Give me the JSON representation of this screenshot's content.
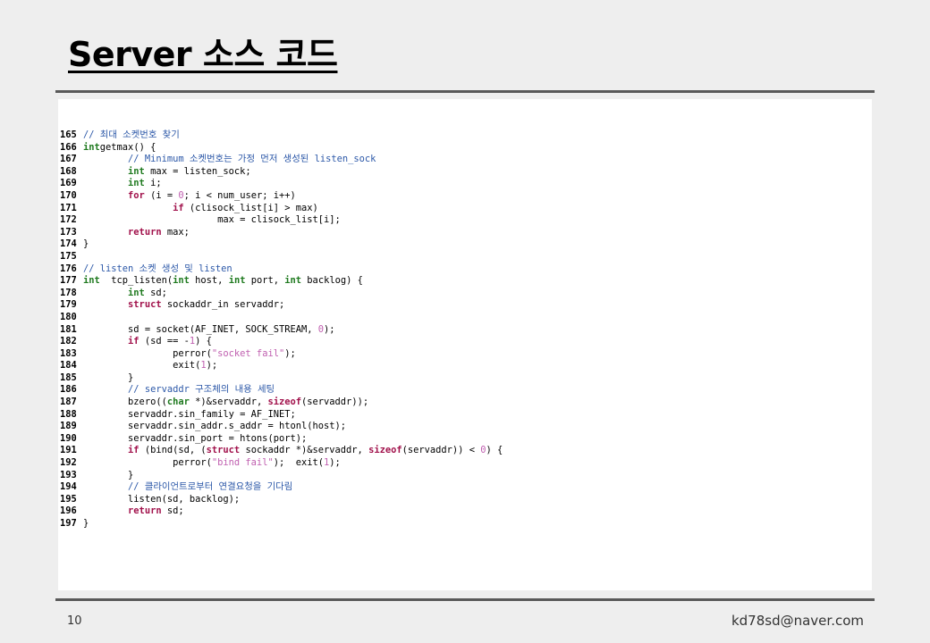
{
  "slide": {
    "title": "Server 소스 코드",
    "page_number": "10",
    "email": "kd78sd@naver.com"
  },
  "code_lines": [
    {
      "n": "165",
      "tokens": [
        [
          "cm",
          "// 최대 소켓번호 찾기"
        ]
      ]
    },
    {
      "n": "166",
      "tokens": [
        [
          "ty",
          "int"
        ],
        [
          "",
          "getmax() {"
        ]
      ]
    },
    {
      "n": "167",
      "tokens": [
        [
          "",
          "        "
        ],
        [
          "cm",
          "// Minimum 소켓번호는 가정 먼저 생성된 listen_sock"
        ]
      ]
    },
    {
      "n": "168",
      "tokens": [
        [
          "",
          "        "
        ],
        [
          "ty",
          "int"
        ],
        [
          "",
          " max = listen_sock;"
        ]
      ]
    },
    {
      "n": "169",
      "tokens": [
        [
          "",
          "        "
        ],
        [
          "ty",
          "int"
        ],
        [
          "",
          " i;"
        ]
      ]
    },
    {
      "n": "170",
      "tokens": [
        [
          "",
          "        "
        ],
        [
          "kw",
          "for"
        ],
        [
          "",
          " (i = "
        ],
        [
          "nm",
          "0"
        ],
        [
          "",
          "; i < num_user; i++)"
        ]
      ]
    },
    {
      "n": "171",
      "tokens": [
        [
          "",
          "                "
        ],
        [
          "kw",
          "if"
        ],
        [
          "",
          " (clisock_list[i] > max)"
        ]
      ]
    },
    {
      "n": "172",
      "tokens": [
        [
          "",
          "                        max = clisock_list[i];"
        ]
      ]
    },
    {
      "n": "173",
      "tokens": [
        [
          "",
          "        "
        ],
        [
          "kw",
          "return"
        ],
        [
          "",
          " max;"
        ]
      ]
    },
    {
      "n": "174",
      "tokens": [
        [
          "",
          "}"
        ]
      ]
    },
    {
      "n": "175",
      "tokens": []
    },
    {
      "n": "176",
      "tokens": [
        [
          "cm",
          "// listen 소켓 생성 및 listen"
        ]
      ]
    },
    {
      "n": "177",
      "tokens": [
        [
          "ty",
          "int"
        ],
        [
          "",
          "  tcp_listen("
        ],
        [
          "ty",
          "int"
        ],
        [
          "",
          " host, "
        ],
        [
          "ty",
          "int"
        ],
        [
          "",
          " port, "
        ],
        [
          "ty",
          "int"
        ],
        [
          "",
          " backlog) {"
        ]
      ]
    },
    {
      "n": "178",
      "tokens": [
        [
          "",
          "        "
        ],
        [
          "ty",
          "int"
        ],
        [
          "",
          " sd;"
        ]
      ]
    },
    {
      "n": "179",
      "tokens": [
        [
          "",
          "        "
        ],
        [
          "kw",
          "struct"
        ],
        [
          "",
          " sockaddr_in servaddr;"
        ]
      ]
    },
    {
      "n": "180",
      "tokens": []
    },
    {
      "n": "181",
      "tokens": [
        [
          "",
          "        sd = socket(AF_INET, SOCK_STREAM, "
        ],
        [
          "nm",
          "0"
        ],
        [
          "",
          ");"
        ]
      ]
    },
    {
      "n": "182",
      "tokens": [
        [
          "",
          "        "
        ],
        [
          "kw",
          "if"
        ],
        [
          "",
          " (sd == -"
        ],
        [
          "nm",
          "1"
        ],
        [
          "",
          ") {"
        ]
      ]
    },
    {
      "n": "183",
      "tokens": [
        [
          "",
          "                perror("
        ],
        [
          "st",
          "\"socket fail\""
        ],
        [
          "",
          ");"
        ]
      ]
    },
    {
      "n": "184",
      "tokens": [
        [
          "",
          "                exit("
        ],
        [
          "nm",
          "1"
        ],
        [
          "",
          ");"
        ]
      ]
    },
    {
      "n": "185",
      "tokens": [
        [
          "",
          "        }"
        ]
      ]
    },
    {
      "n": "186",
      "tokens": [
        [
          "",
          "        "
        ],
        [
          "cm",
          "// servaddr 구조체의 내용 세팅"
        ]
      ]
    },
    {
      "n": "187",
      "tokens": [
        [
          "",
          "        bzero(("
        ],
        [
          "ty",
          "char"
        ],
        [
          "",
          " *)&servaddr, "
        ],
        [
          "kw",
          "sizeof"
        ],
        [
          "",
          "(servaddr));"
        ]
      ]
    },
    {
      "n": "188",
      "tokens": [
        [
          "",
          "        servaddr.sin_family = AF_INET;"
        ]
      ]
    },
    {
      "n": "189",
      "tokens": [
        [
          "",
          "        servaddr.sin_addr.s_addr = htonl(host);"
        ]
      ]
    },
    {
      "n": "190",
      "tokens": [
        [
          "",
          "        servaddr.sin_port = htons(port);"
        ]
      ]
    },
    {
      "n": "191",
      "tokens": [
        [
          "",
          "        "
        ],
        [
          "kw",
          "if"
        ],
        [
          "",
          " (bind(sd, ("
        ],
        [
          "kw",
          "struct"
        ],
        [
          "",
          " sockaddr *)&servaddr, "
        ],
        [
          "kw",
          "sizeof"
        ],
        [
          "",
          "(servaddr)) < "
        ],
        [
          "nm",
          "0"
        ],
        [
          "",
          ") {"
        ]
      ]
    },
    {
      "n": "192",
      "tokens": [
        [
          "",
          "                perror("
        ],
        [
          "st",
          "\"bind fail\""
        ],
        [
          "",
          ");  exit("
        ],
        [
          "nm",
          "1"
        ],
        [
          "",
          ");"
        ]
      ]
    },
    {
      "n": "193",
      "tokens": [
        [
          "",
          "        }"
        ]
      ]
    },
    {
      "n": "194",
      "tokens": [
        [
          "",
          "        "
        ],
        [
          "cm",
          "// 클라이언트로부터 연결요청을 기다림"
        ]
      ]
    },
    {
      "n": "195",
      "tokens": [
        [
          "",
          "        listen(sd, backlog);"
        ]
      ]
    },
    {
      "n": "196",
      "tokens": [
        [
          "",
          "        "
        ],
        [
          "kw",
          "return"
        ],
        [
          "",
          " sd;"
        ]
      ]
    },
    {
      "n": "197",
      "tokens": [
        [
          "",
          "}"
        ]
      ]
    }
  ]
}
